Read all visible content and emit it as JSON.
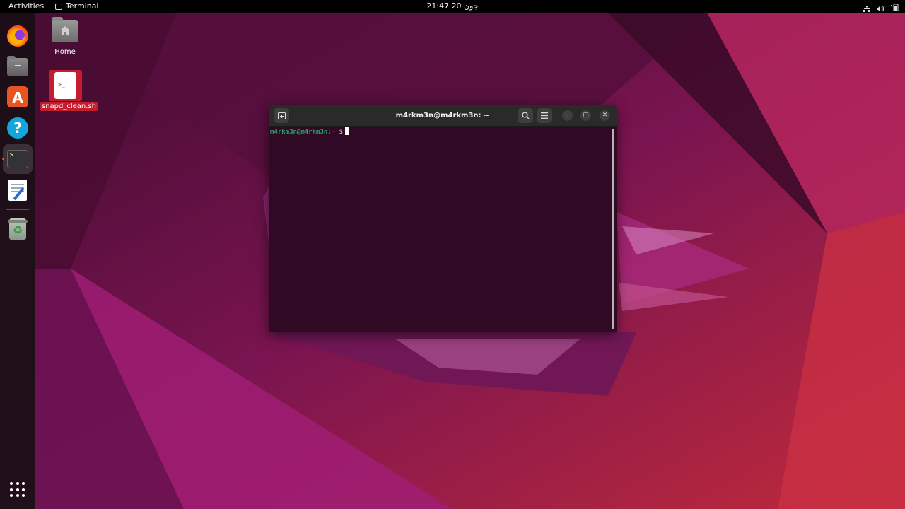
{
  "topbar": {
    "activities_label": "Activities",
    "app_menu_label": "Terminal",
    "clock": "21:47  جون 20"
  },
  "dock": {
    "items": [
      {
        "name": "Firefox",
        "icon": "firefox-icon"
      },
      {
        "name": "Files",
        "icon": "files-icon"
      },
      {
        "name": "Ubuntu Software",
        "icon": "app-store-icon",
        "glyph": "A"
      },
      {
        "name": "Help",
        "icon": "help-icon",
        "glyph": "?"
      },
      {
        "name": "Terminal",
        "icon": "terminal-icon",
        "glyph": ">_",
        "active": true
      },
      {
        "name": "Text Editor",
        "icon": "text-editor-icon"
      },
      {
        "name": "Trash",
        "icon": "trash-icon",
        "glyph": "♻"
      }
    ],
    "show_apps_icon": "apps-grid-icon"
  },
  "desktop": {
    "home_label": "Home",
    "script_label": "snapd_clean.sh",
    "script_glyph": ">_"
  },
  "terminal": {
    "title": "m4rkm3n@m4rkm3n: ~",
    "prompt_user": "m4rkm3n@m4rkm3n",
    "prompt_sep": ":",
    "prompt_path": "~",
    "prompt_symbol": "$",
    "new_tab_icon": "new-tab-icon",
    "search_icon": "search-icon",
    "menu_icon": "hamburger-menu-icon",
    "minimize_glyph": "–",
    "maximize_glyph": "▢",
    "close_glyph": "✕"
  },
  "colors": {
    "topbar": "#000000",
    "dock": "#190f16",
    "terminal_bg": "#300a24",
    "prompt_user": "#26a269",
    "prompt_path": "#12488b",
    "accent": "#e95420",
    "selection": "#c41d2e"
  }
}
